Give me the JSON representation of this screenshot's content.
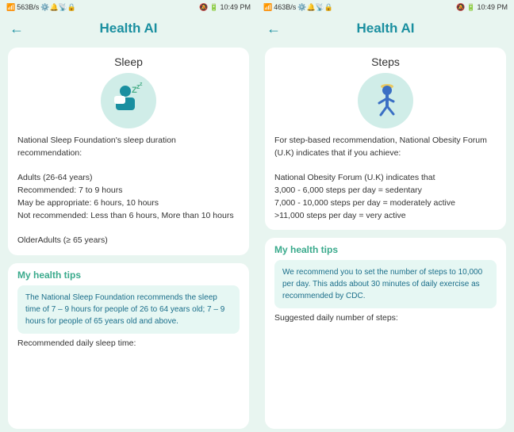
{
  "panel_left": {
    "status_bar": {
      "left": "563B/s",
      "time": "10:49 PM",
      "right": ""
    },
    "header": {
      "title": "Health AI",
      "back_label": "←"
    },
    "card": {
      "title": "Sleep",
      "body_text": "National Sleep Foundation's sleep duration recommendation:\n\nAdults (26-64 years)\nRecommended: 7 to 9 hours\nMay be appropriate: 6 hours, 10 hours\nNot recommended: Less than 6 hours, More than 10 hours\n\nOlderAdults (≥ 65 years)"
    },
    "tips": {
      "title": "My health tips",
      "box_text": "The National Sleep Foundation recommends the sleep time of 7 – 9 hours for people of 26 to 64 years old; 7 – 9 hours for people of 65 years old and above.",
      "label": "Recommended daily sleep time:"
    }
  },
  "panel_right": {
    "status_bar": {
      "left": "463B/s",
      "time": "10:49 PM",
      "right": ""
    },
    "header": {
      "title": "Health AI",
      "back_label": "←"
    },
    "card": {
      "title": "Steps",
      "body_text": "For step-based recommendation, National Obesity Forum (U.K) indicates that if you achieve:\n\nNational Obesity Forum (U.K) indicates that\n3,000 - 6,000 steps per day = sedentary\n7,000 - 10,000 steps per day = moderately active\n>11,000 steps per day = very active"
    },
    "tips": {
      "title": "My health tips",
      "box_text": "We recommend you to set the number of steps to 10,000 per day. This adds about 30 minutes of daily exercise as recommended by CDC.",
      "label": "Suggested daily number of steps:"
    }
  }
}
